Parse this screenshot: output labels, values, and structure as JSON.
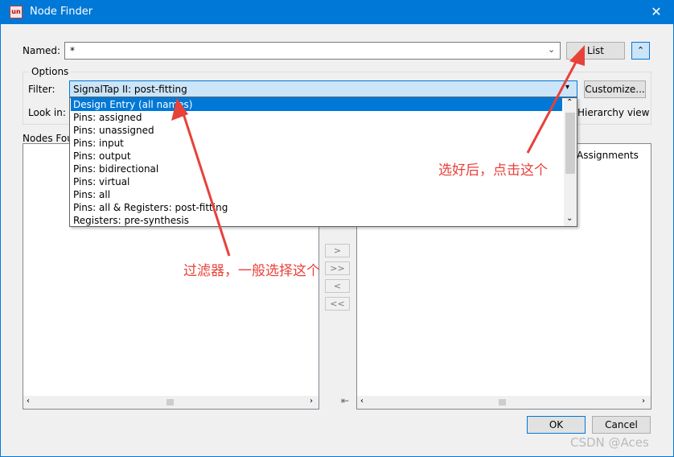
{
  "window": {
    "title": "Node Finder",
    "icon_text": "un"
  },
  "named": {
    "label": "Named:",
    "value": "*"
  },
  "buttons": {
    "list": "List",
    "customize": "Customize...",
    "ok": "OK",
    "cancel": "Cancel",
    "move_right": ">",
    "move_all_right": ">>",
    "move_left": "<",
    "move_all_left": "<<"
  },
  "options": {
    "group_label": "Options",
    "filter_label": "Filter:",
    "filter_value": "SignalTap II: post-fitting",
    "look_in_label": "Look in:",
    "hierarchy_view": "Hierarchy view"
  },
  "nodes_found_label": "Nodes Fou",
  "selected_nodes_label": "Assignments",
  "dropdown": {
    "items": [
      "Design Entry (all names)",
      "Pins: assigned",
      "Pins: unassigned",
      "Pins: input",
      "Pins: output",
      "Pins: bidirectional",
      "Pins: virtual",
      "Pins: all",
      "Pins: all & Registers: post-fitting",
      "Registers: pre-synthesis"
    ],
    "selected_index": 0
  },
  "annotations": {
    "filter_note": "过滤器，一般选择这个",
    "list_note": "选好后，点击这个"
  },
  "watermark": "CSDN @Aces",
  "colors": {
    "titlebar": "#0078d7",
    "selection": "#0078d7",
    "annotation": "#e8413a"
  }
}
